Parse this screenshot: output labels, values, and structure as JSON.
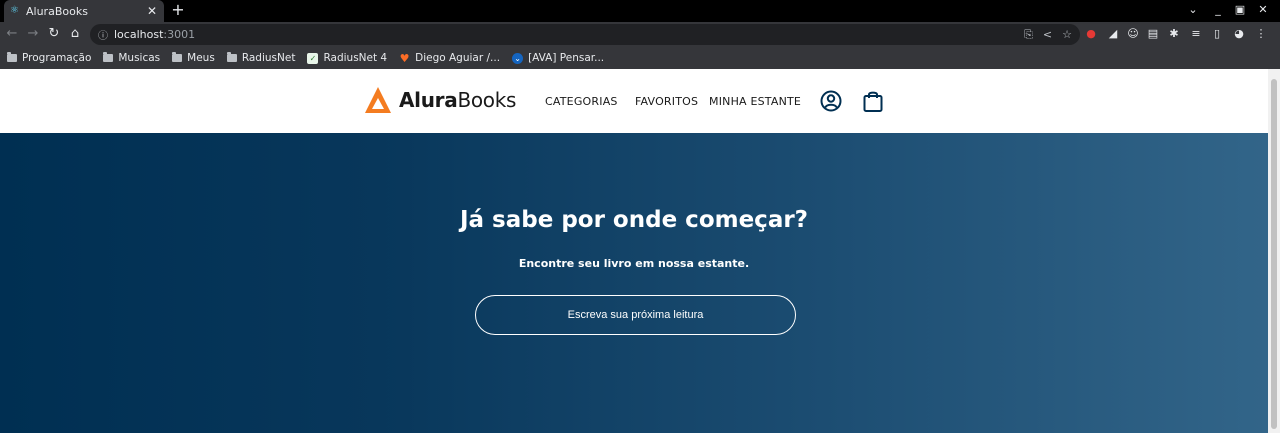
{
  "browser": {
    "tab_title": "AluraBooks",
    "tab_close": "✕",
    "new_tab": "+",
    "url_host": "localhost",
    "url_port": ":3001",
    "bookmarks": [
      {
        "label": "Programação",
        "icon": "folder-icon"
      },
      {
        "label": "Musicas",
        "icon": "folder-icon"
      },
      {
        "label": "Meus",
        "icon": "folder-icon"
      },
      {
        "label": "RadiusNet",
        "icon": "folder-icon"
      },
      {
        "label": "RadiusNet 4",
        "icon": "check-doc-icon"
      },
      {
        "label": "Diego Aguiar /...",
        "icon": "gitlab-icon"
      },
      {
        "label": "[AVA] Pensar...",
        "icon": "ava-icon"
      }
    ]
  },
  "site": {
    "logo_bold": "Alura",
    "logo_light": "Books",
    "nav": [
      "CATEGORIAS",
      "FAVORITOS",
      "MINHA ESTANTE"
    ],
    "brand_color": "#f47c20",
    "icons": [
      "user-icon",
      "shopping-bag-icon"
    ]
  },
  "hero": {
    "title": "Já sabe por onde começar?",
    "subtitle": "Encontre seu livro em nossa estante.",
    "search_placeholder": "Escreva sua próxima leitura",
    "gradient_colors": [
      "#002f52",
      "#326589"
    ]
  }
}
